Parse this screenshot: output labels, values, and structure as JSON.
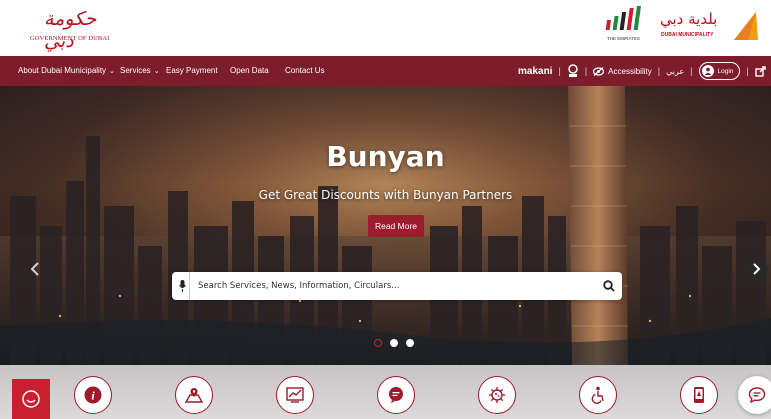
{
  "header": {
    "gov_logo_arabic": "حكومة دبي",
    "gov_logo_english": "GOVERNMENT OF DUBAI",
    "emirates_logo_text": "THE EMIRATES",
    "dm_logo_arabic": "بلدية دبي",
    "dm_logo_english": "DUBAI MUNICIPALITY"
  },
  "nav": {
    "items": [
      {
        "label": "About Dubai Municipality",
        "has_dropdown": true
      },
      {
        "label": "Services",
        "has_dropdown": true
      },
      {
        "label": "Easy Payment",
        "has_dropdown": false
      },
      {
        "label": "Open Data",
        "has_dropdown": false
      },
      {
        "label": "Contact Us",
        "has_dropdown": false
      }
    ],
    "makani_label": "makani",
    "accessibility_label": "Accessibility",
    "language_label": "عربي",
    "login_label": "Login",
    "colors": {
      "nav_bg": "#7d1c2b",
      "accent": "#9b1c2c"
    }
  },
  "hero": {
    "title": "Bunyan",
    "subtitle": "Get Great Discounts with Bunyan Partners",
    "cta_label": "Read More",
    "search_placeholder": "Search Services, News, Information, Circulars...",
    "slides_total": 3,
    "active_slide": 1
  },
  "quick_links": {
    "icons": [
      "info-icon",
      "map-location-icon",
      "chart-icon",
      "feedback-icon",
      "virus-icon",
      "accessibility-person-icon",
      "mobile-app-icon"
    ]
  }
}
